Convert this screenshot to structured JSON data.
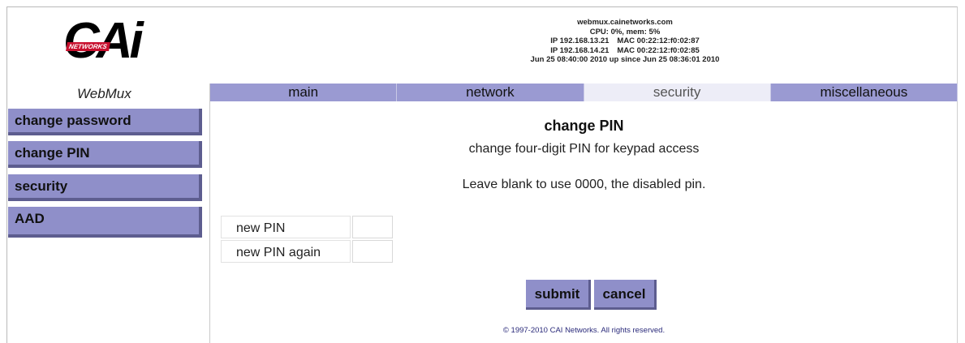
{
  "header": {
    "hostname": "webmux.cainetworks.com",
    "cpu_mem": "CPU: 0%, mem: 5%",
    "net1_ip": "IP 192.168.13.21",
    "net1_mac": "MAC 00:22:12:f0:02:87",
    "net2_ip": "IP 192.168.14.21",
    "net2_mac": "MAC 00:22:12:f0:02:85",
    "uptime": "Jun 25 08:40:00 2010 up since Jun 25 08:36:01 2010"
  },
  "brand": {
    "logo_text": "CAi",
    "logo_badge": "NETWORKS",
    "product_name": "WebMux"
  },
  "tabs": [
    {
      "label": "main"
    },
    {
      "label": "network"
    },
    {
      "label": "security",
      "active": true
    },
    {
      "label": "miscellaneous"
    }
  ],
  "sidebar": {
    "items": [
      {
        "label": "change password"
      },
      {
        "label": "change PIN"
      },
      {
        "label": "security"
      },
      {
        "label": "AAD"
      }
    ]
  },
  "main": {
    "title": "change PIN",
    "subtitle": "change four-digit PIN for keypad access",
    "note": "Leave blank to use 0000, the disabled pin.",
    "fields": [
      {
        "label": "new PIN",
        "value": ""
      },
      {
        "label": "new PIN again",
        "value": ""
      }
    ],
    "submit_label": "submit",
    "cancel_label": "cancel"
  },
  "footer": {
    "copyright": "© 1997-2010 CAI Networks. All rights reserved."
  },
  "colors": {
    "tab_bg": "#9a9ad2",
    "tab_active_bg": "#ededf7",
    "sidebar_bg": "#8f8fc9",
    "sidebar_shadow": "#5d5d8f",
    "logo_red": "#c8102e"
  }
}
